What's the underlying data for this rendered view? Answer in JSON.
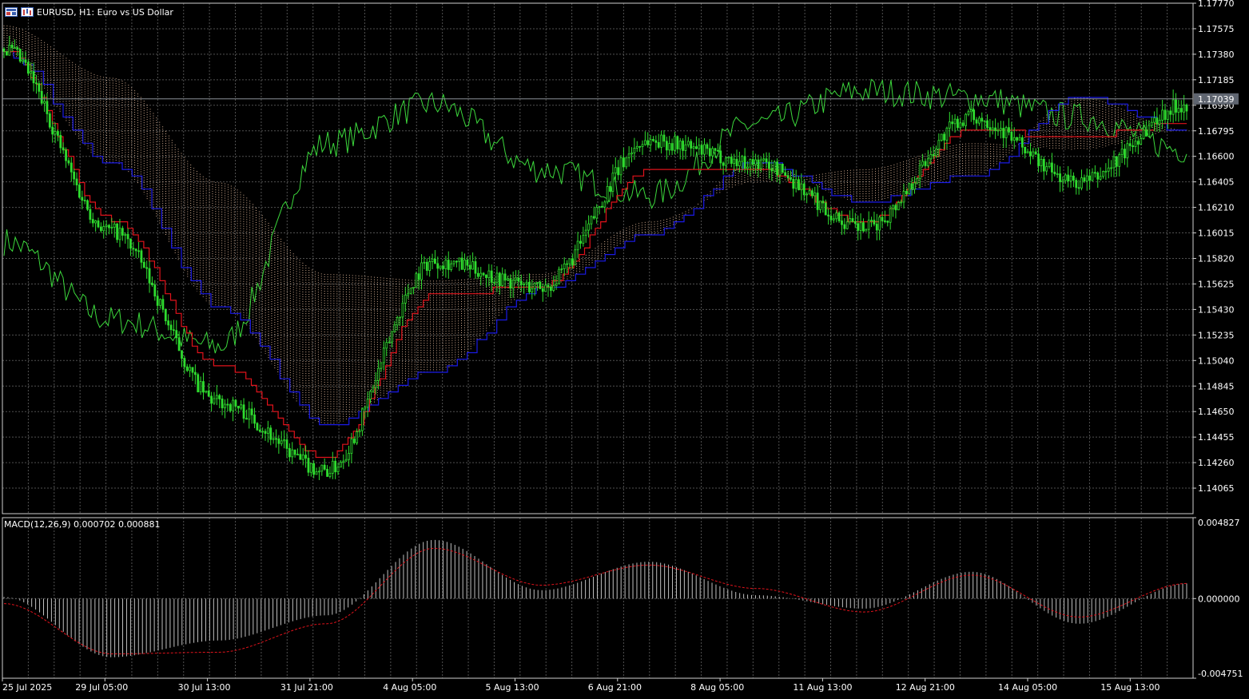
{
  "header": {
    "symbol": "EURUSD",
    "timeframe": "H1",
    "description": "Euro vs US Dollar",
    "title_text": "EURUSD, H1:  Euro vs US Dollar"
  },
  "icons": [
    "chart-window-icon",
    "chart-type-icon"
  ],
  "colors": {
    "background": "#000000",
    "grid": "#6b6b6b",
    "candles": "#2fdc2f",
    "tenkan": "#e0121b",
    "kijun": "#1a1ae6",
    "chikou": "#3cd83c",
    "cloud": "#f6c9a8",
    "macd_hist": "#c0c0c0",
    "macd_signal": "#e0121b",
    "price_line": "#8a8f96",
    "price_tag_bg": "#5f6570"
  },
  "price_axis": {
    "ticks": [
      "1.17770",
      "1.17575",
      "1.17380",
      "1.17185",
      "1.16990",
      "1.16795",
      "1.16600",
      "1.16405",
      "1.16210",
      "1.16015",
      "1.15820",
      "1.15625",
      "1.15430",
      "1.15235",
      "1.15040",
      "1.14845",
      "1.14650",
      "1.14455",
      "1.14260",
      "1.14065"
    ],
    "current": "1.17039"
  },
  "macd": {
    "label": "MACD(12,26,9) 0.000702 0.000881",
    "ticks": [
      "0.004827",
      "0.000000",
      "-0.004751"
    ]
  },
  "time_axis": [
    "25 Jul 2025",
    "29 Jul 05:00",
    "30 Jul 13:00",
    "31 Jul 21:00",
    "4 Aug 05:00",
    "5 Aug 13:00",
    "6 Aug 21:00",
    "8 Aug 05:00",
    "11 Aug 13:00",
    "12 Aug 21:00",
    "14 Aug 05:00",
    "15 Aug 13:00"
  ],
  "chart_data": [
    {
      "type": "candlestick",
      "indicator": "Ichimoku Kinko Hyo",
      "ylim": [
        1.1387,
        1.1777
      ],
      "x": [
        "25 Jul 2025",
        "29 Jul 05:00",
        "30 Jul 13:00",
        "31 Jul 21:00",
        "4 Aug 05:00",
        "5 Aug 13:00",
        "6 Aug 21:00",
        "8 Aug 05:00",
        "11 Aug 13:00",
        "12 Aug 21:00",
        "14 Aug 05:00",
        "15 Aug 13:00"
      ],
      "series": [
        {
          "values": [
            1.1742,
            1.1603,
            1.1472,
            1.142,
            1.158,
            1.156,
            1.1672,
            1.1655,
            1.1605,
            1.169,
            1.164,
            1.17
          ]
        },
        {
          "values": [
            1.1742,
            1.1612,
            1.15,
            1.143,
            1.1555,
            1.156,
            1.165,
            1.165,
            1.161,
            1.168,
            1.1675,
            1.1685
          ]
        },
        {
          "values": [
            1.1738,
            1.1655,
            1.1545,
            1.1455,
            1.1495,
            1.156,
            1.16,
            1.1655,
            1.1625,
            1.1645,
            1.1705,
            1.168
          ]
        },
        {
          "values": [
            1.1595,
            1.1535,
            1.1515,
            1.167,
            1.17,
            1.165,
            1.163,
            1.1685,
            1.171,
            1.1705,
            1.169,
            1.1665
          ]
        },
        {
          "values": [
            1.176,
            1.172,
            1.164,
            1.157,
            1.1565,
            1.157,
            1.161,
            1.164,
            1.165,
            1.167,
            1.1665,
            1.168
          ]
        }
      ]
    },
    {
      "type": "bar",
      "indicator": "MACD(12,26,9)",
      "ylim": [
        -0.004751,
        0.004827
      ],
      "x": [
        "25 Jul 2025",
        "29 Jul 05:00",
        "30 Jul 13:00",
        "31 Jul 21:00",
        "4 Aug 05:00",
        "5 Aug 13:00",
        "6 Aug 21:00",
        "8 Aug 05:00",
        "11 Aug 13:00",
        "12 Aug 21:00",
        "14 Aug 05:00",
        "15 Aug 13:00"
      ],
      "series": [
        {
          "values": [
            0.0001,
            -0.0035,
            -0.0025,
            -0.001,
            0.0035,
            0.0005,
            0.0022,
            0.0002,
            -0.0006,
            0.0016,
            -0.0015,
            0.0009
          ]
        },
        {
          "values": [
            -0.0003,
            -0.0033,
            -0.0032,
            -0.0015,
            0.003,
            0.0008,
            0.002,
            0.0006,
            -0.0008,
            0.0014,
            -0.0011,
            0.0009
          ]
        }
      ]
    }
  ]
}
